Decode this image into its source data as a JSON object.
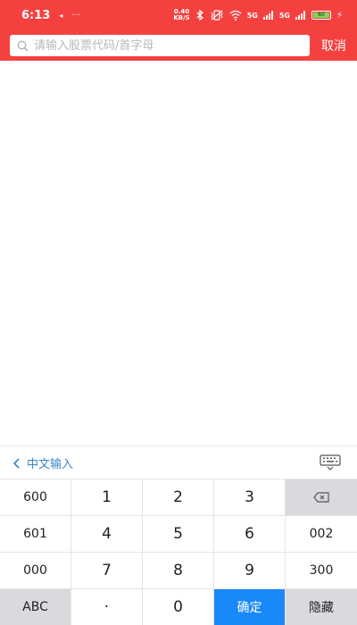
{
  "status_bar": {
    "time": "6:13",
    "dots": "···",
    "net_speed_top": "0.40",
    "net_speed_bottom": "KB/S",
    "signal1": "5G",
    "signal2": "5G",
    "battery": "60"
  },
  "search": {
    "placeholder": "请输入股票代码/首字母",
    "cancel_label": "取消"
  },
  "keyboard": {
    "lang_label": "中文输入",
    "keys": [
      "600",
      "1",
      "2",
      "3",
      "",
      "601",
      "4",
      "5",
      "6",
      "002",
      "000",
      "7",
      "8",
      "9",
      "300",
      "ABC",
      "·",
      "0",
      "确定",
      "隐藏"
    ]
  },
  "colors": {
    "header_red": "#f4413f",
    "confirm_blue": "#1989fa",
    "lang_blue": "#3a86c8"
  }
}
